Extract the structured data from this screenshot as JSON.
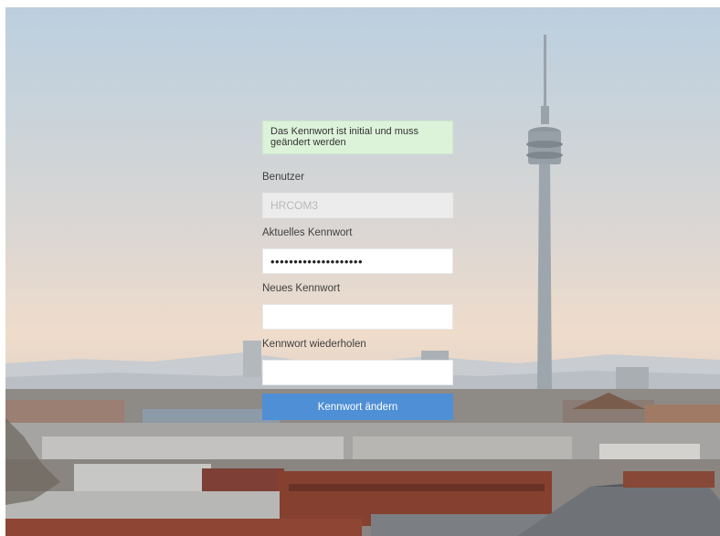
{
  "notice": "Das Kennwort ist initial und muss geändert werden",
  "user": {
    "label": "Benutzer",
    "value": "HRCOM3"
  },
  "current_password": {
    "label": "Aktuelles Kennwort",
    "value": "••••••••••••••••••••"
  },
  "new_password": {
    "label": "Neues Kennwort",
    "value": ""
  },
  "repeat_password": {
    "label": "Kennwort wiederholen",
    "value": ""
  },
  "submit_label": "Kennwort ändern",
  "colors": {
    "notice_bg": "#dcf2d9",
    "button": "#4f8fd6",
    "readonly_bg": "#ececec"
  }
}
